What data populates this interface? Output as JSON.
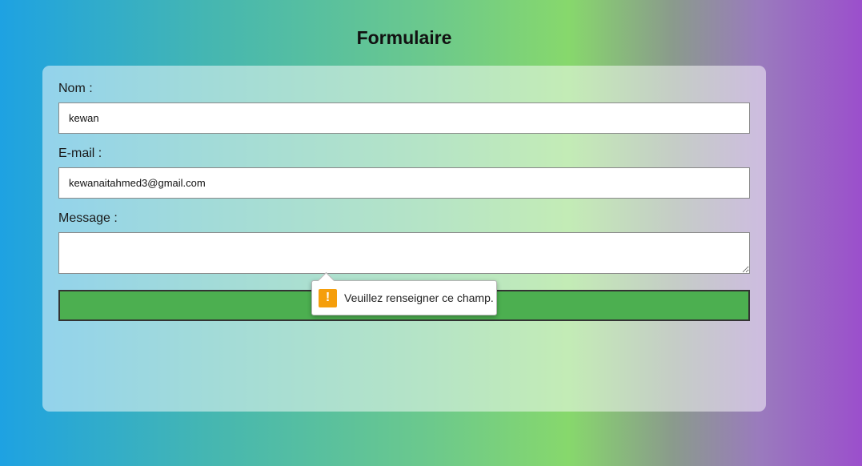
{
  "page": {
    "title": "Formulaire"
  },
  "form": {
    "name_label": "Nom :",
    "name_value": "kewan",
    "email_label": "E-mail :",
    "email_value": "kewanaitahmed3@gmail.com",
    "message_label": "Message :",
    "message_value": "",
    "submit_label": ""
  },
  "validation_tooltip": {
    "icon": "warning-icon",
    "icon_glyph": "!",
    "text": "Veuillez renseigner ce champ."
  },
  "colors": {
    "submit_button": "#4caf50",
    "warning_icon": "#f59e0b"
  }
}
